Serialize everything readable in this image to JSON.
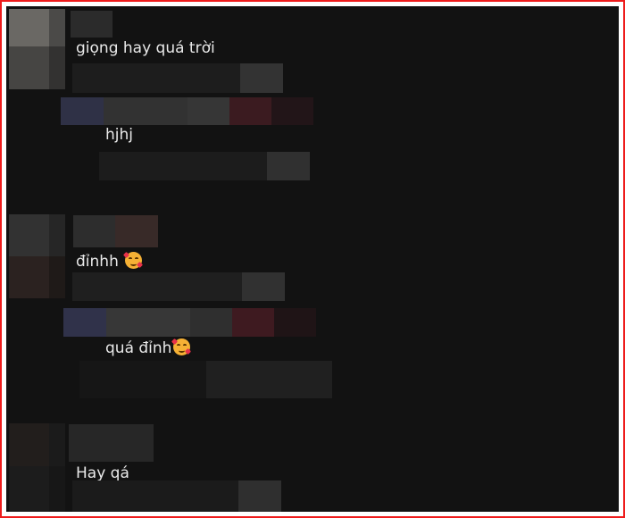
{
  "comments": [
    {
      "text": "giọng hay quá trời",
      "emoji": false
    },
    {
      "text": "hjhj",
      "emoji": false
    },
    {
      "text": "đỉnhh ",
      "emoji": true,
      "emoji_name": "smiling-face-with-hearts-icon"
    },
    {
      "text": "quá đỉnh",
      "emoji": true,
      "emoji_name": "smiling-face-with-hearts-icon"
    },
    {
      "text": "Hay qá",
      "emoji": false
    }
  ],
  "colors": {
    "frame_border": "#ee1c1c",
    "panel_background": "#121212",
    "comment_text": "#e9e9e9"
  }
}
